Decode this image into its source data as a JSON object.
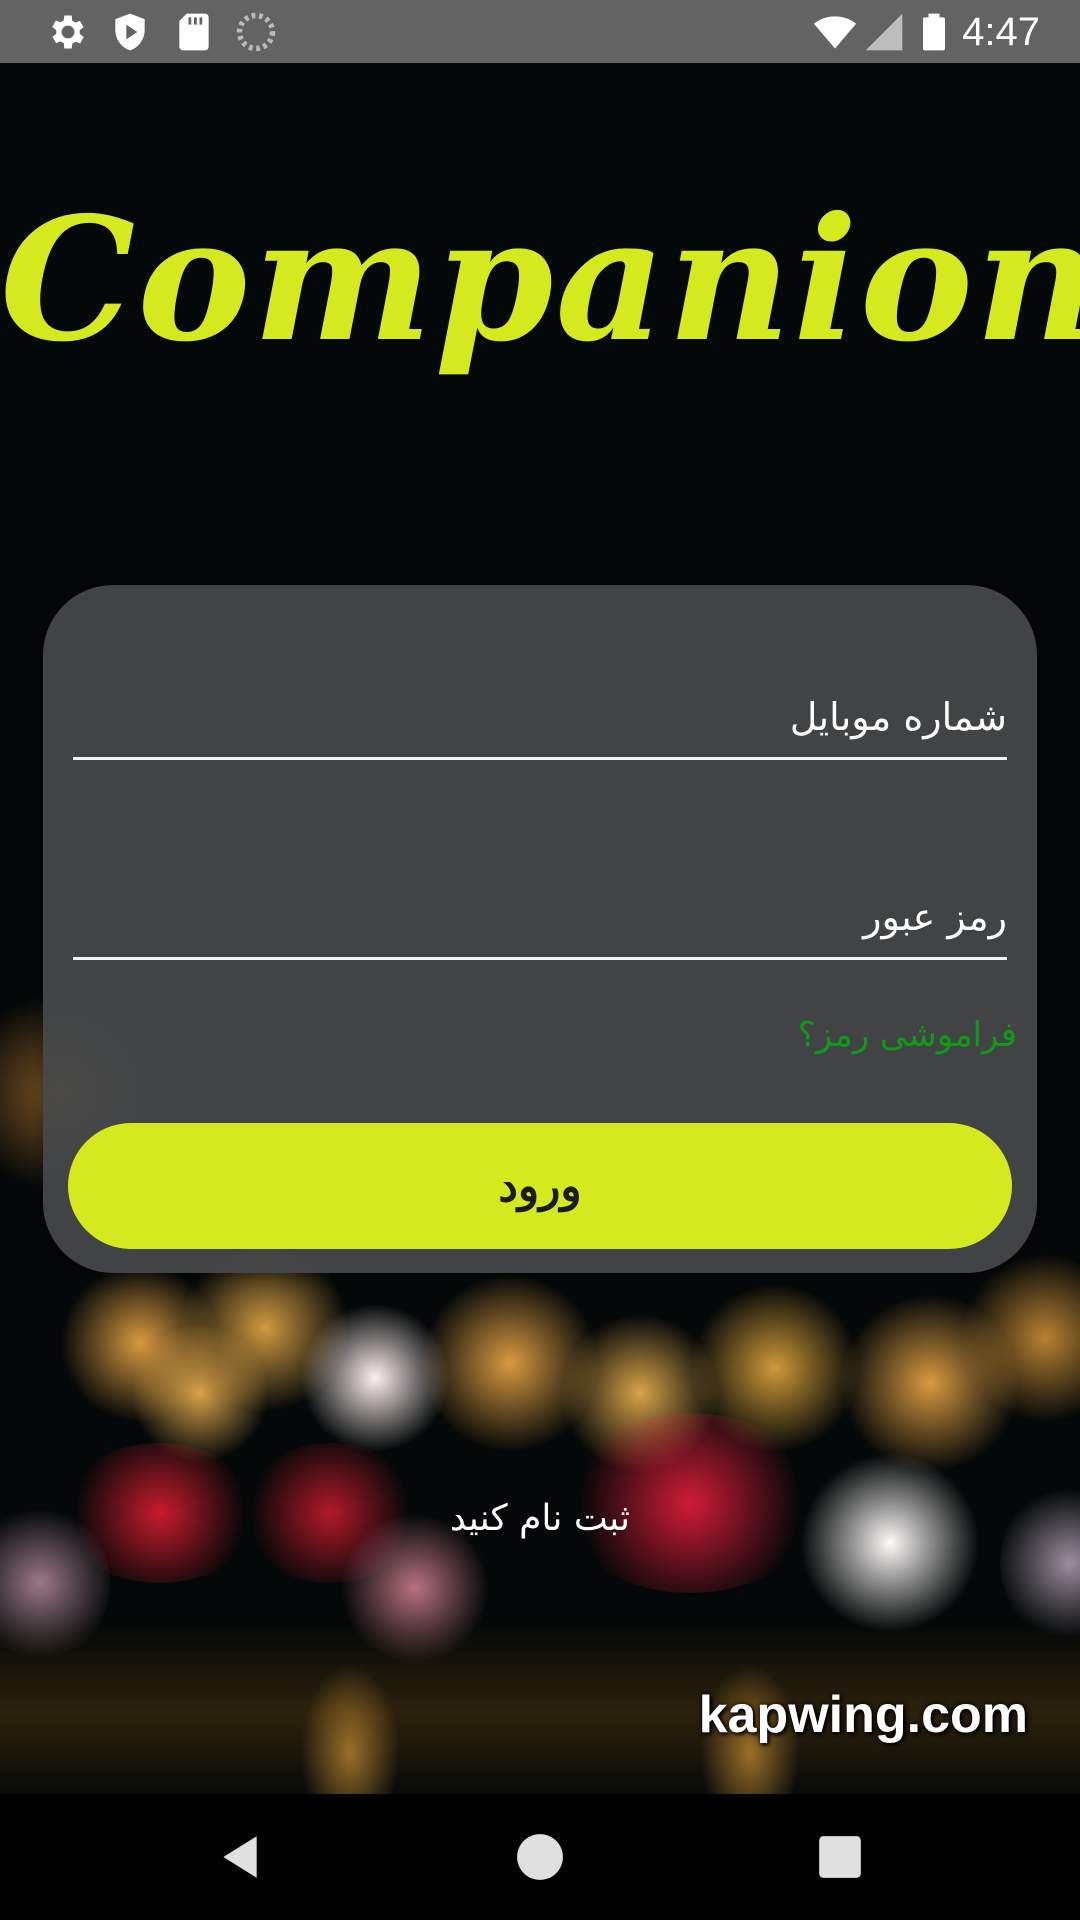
{
  "status_bar": {
    "time": "4:47",
    "icons": [
      "gear-icon",
      "shield-icon",
      "sd-card-icon",
      "loading-icon",
      "wifi-icon",
      "signal-icon",
      "battery-icon"
    ]
  },
  "app": {
    "logo_text": "Companion",
    "brand_color": "#d4ea1e"
  },
  "login_form": {
    "phone_placeholder": "شماره موبایل",
    "password_placeholder": "رمز عبور",
    "forgot_password": "فراموشی رمز؟",
    "login_button": "ورود"
  },
  "register_link": "ثبت نام کنید",
  "watermark": "kapwing.com",
  "nav_bar": {
    "buttons": [
      "back-icon",
      "home-icon",
      "recents-icon"
    ]
  }
}
